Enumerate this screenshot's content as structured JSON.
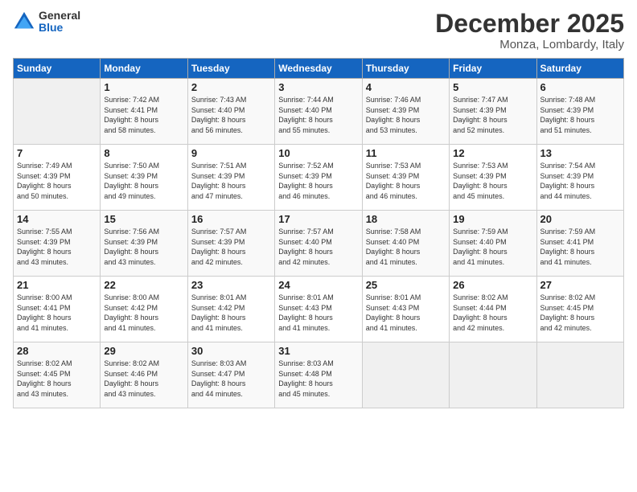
{
  "logo": {
    "general": "General",
    "blue": "Blue"
  },
  "header": {
    "month": "December 2025",
    "location": "Monza, Lombardy, Italy"
  },
  "days_of_week": [
    "Sunday",
    "Monday",
    "Tuesday",
    "Wednesday",
    "Thursday",
    "Friday",
    "Saturday"
  ],
  "weeks": [
    [
      {
        "day": "",
        "info": ""
      },
      {
        "day": "1",
        "info": "Sunrise: 7:42 AM\nSunset: 4:41 PM\nDaylight: 8 hours\nand 58 minutes."
      },
      {
        "day": "2",
        "info": "Sunrise: 7:43 AM\nSunset: 4:40 PM\nDaylight: 8 hours\nand 56 minutes."
      },
      {
        "day": "3",
        "info": "Sunrise: 7:44 AM\nSunset: 4:40 PM\nDaylight: 8 hours\nand 55 minutes."
      },
      {
        "day": "4",
        "info": "Sunrise: 7:46 AM\nSunset: 4:39 PM\nDaylight: 8 hours\nand 53 minutes."
      },
      {
        "day": "5",
        "info": "Sunrise: 7:47 AM\nSunset: 4:39 PM\nDaylight: 8 hours\nand 52 minutes."
      },
      {
        "day": "6",
        "info": "Sunrise: 7:48 AM\nSunset: 4:39 PM\nDaylight: 8 hours\nand 51 minutes."
      }
    ],
    [
      {
        "day": "7",
        "info": "Sunrise: 7:49 AM\nSunset: 4:39 PM\nDaylight: 8 hours\nand 50 minutes."
      },
      {
        "day": "8",
        "info": "Sunrise: 7:50 AM\nSunset: 4:39 PM\nDaylight: 8 hours\nand 49 minutes."
      },
      {
        "day": "9",
        "info": "Sunrise: 7:51 AM\nSunset: 4:39 PM\nDaylight: 8 hours\nand 47 minutes."
      },
      {
        "day": "10",
        "info": "Sunrise: 7:52 AM\nSunset: 4:39 PM\nDaylight: 8 hours\nand 46 minutes."
      },
      {
        "day": "11",
        "info": "Sunrise: 7:53 AM\nSunset: 4:39 PM\nDaylight: 8 hours\nand 46 minutes."
      },
      {
        "day": "12",
        "info": "Sunrise: 7:53 AM\nSunset: 4:39 PM\nDaylight: 8 hours\nand 45 minutes."
      },
      {
        "day": "13",
        "info": "Sunrise: 7:54 AM\nSunset: 4:39 PM\nDaylight: 8 hours\nand 44 minutes."
      }
    ],
    [
      {
        "day": "14",
        "info": "Sunrise: 7:55 AM\nSunset: 4:39 PM\nDaylight: 8 hours\nand 43 minutes."
      },
      {
        "day": "15",
        "info": "Sunrise: 7:56 AM\nSunset: 4:39 PM\nDaylight: 8 hours\nand 43 minutes."
      },
      {
        "day": "16",
        "info": "Sunrise: 7:57 AM\nSunset: 4:39 PM\nDaylight: 8 hours\nand 42 minutes."
      },
      {
        "day": "17",
        "info": "Sunrise: 7:57 AM\nSunset: 4:40 PM\nDaylight: 8 hours\nand 42 minutes."
      },
      {
        "day": "18",
        "info": "Sunrise: 7:58 AM\nSunset: 4:40 PM\nDaylight: 8 hours\nand 41 minutes."
      },
      {
        "day": "19",
        "info": "Sunrise: 7:59 AM\nSunset: 4:40 PM\nDaylight: 8 hours\nand 41 minutes."
      },
      {
        "day": "20",
        "info": "Sunrise: 7:59 AM\nSunset: 4:41 PM\nDaylight: 8 hours\nand 41 minutes."
      }
    ],
    [
      {
        "day": "21",
        "info": "Sunrise: 8:00 AM\nSunset: 4:41 PM\nDaylight: 8 hours\nand 41 minutes."
      },
      {
        "day": "22",
        "info": "Sunrise: 8:00 AM\nSunset: 4:42 PM\nDaylight: 8 hours\nand 41 minutes."
      },
      {
        "day": "23",
        "info": "Sunrise: 8:01 AM\nSunset: 4:42 PM\nDaylight: 8 hours\nand 41 minutes."
      },
      {
        "day": "24",
        "info": "Sunrise: 8:01 AM\nSunset: 4:43 PM\nDaylight: 8 hours\nand 41 minutes."
      },
      {
        "day": "25",
        "info": "Sunrise: 8:01 AM\nSunset: 4:43 PM\nDaylight: 8 hours\nand 41 minutes."
      },
      {
        "day": "26",
        "info": "Sunrise: 8:02 AM\nSunset: 4:44 PM\nDaylight: 8 hours\nand 42 minutes."
      },
      {
        "day": "27",
        "info": "Sunrise: 8:02 AM\nSunset: 4:45 PM\nDaylight: 8 hours\nand 42 minutes."
      }
    ],
    [
      {
        "day": "28",
        "info": "Sunrise: 8:02 AM\nSunset: 4:45 PM\nDaylight: 8 hours\nand 43 minutes."
      },
      {
        "day": "29",
        "info": "Sunrise: 8:02 AM\nSunset: 4:46 PM\nDaylight: 8 hours\nand 43 minutes."
      },
      {
        "day": "30",
        "info": "Sunrise: 8:03 AM\nSunset: 4:47 PM\nDaylight: 8 hours\nand 44 minutes."
      },
      {
        "day": "31",
        "info": "Sunrise: 8:03 AM\nSunset: 4:48 PM\nDaylight: 8 hours\nand 45 minutes."
      },
      {
        "day": "",
        "info": ""
      },
      {
        "day": "",
        "info": ""
      },
      {
        "day": "",
        "info": ""
      }
    ]
  ]
}
